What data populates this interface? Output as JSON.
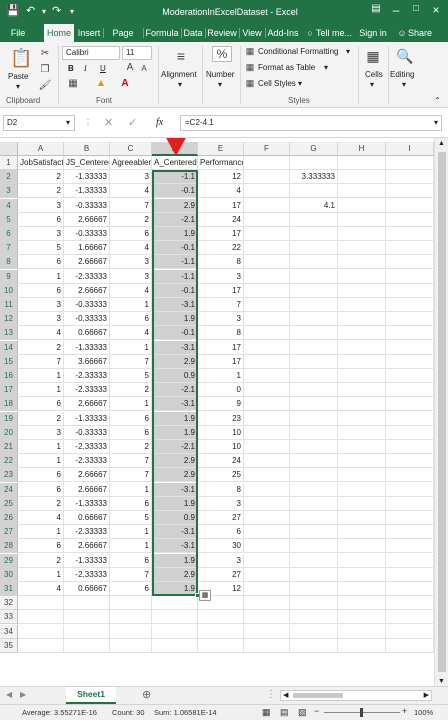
{
  "window": {
    "title": "ModerationInExcelDataset - Excel",
    "signin": "Sign in",
    "share": "Share",
    "tell_me": "Tell me..."
  },
  "tabs": [
    "File",
    "Home",
    "Insert",
    "Page Lay",
    "Formula",
    "Data",
    "Review",
    "View",
    "Add-Ins"
  ],
  "active_tab": "Home",
  "ribbon": {
    "paste": "Paste",
    "clipboard": "Clipboard",
    "font_name": "Calibri",
    "font_size": "11",
    "bold": "B",
    "italic": "I",
    "underline": "U",
    "font_group": "Font",
    "alignment": "Alignment",
    "number": "Number",
    "number_icon": "%",
    "conditional": "Conditional Formatting",
    "format_table": "Format as Table",
    "cell_styles": "Cell Styles",
    "styles_group": "Styles",
    "cells": "Cells",
    "editing": "Editing"
  },
  "formula_bar": {
    "name_box": "D2",
    "fx": "fx",
    "formula": "=C2-4.1"
  },
  "columns": [
    "A",
    "B",
    "C",
    "D",
    "E",
    "F",
    "G",
    "H",
    "I"
  ],
  "selected_column": "D",
  "headers": [
    "JobSatisfaction",
    "JS_Centered",
    "Agreeableness",
    "A_Centered",
    "Performance"
  ],
  "rows": [
    [
      "2",
      "-1.33333",
      "3",
      "-1.1",
      "12"
    ],
    [
      "2",
      "-1.33333",
      "4",
      "-0.1",
      "4"
    ],
    [
      "3",
      "-0.33333",
      "7",
      "2.9",
      "17"
    ],
    [
      "6",
      "2.66667",
      "2",
      "-2.1",
      "24"
    ],
    [
      "3",
      "-0.33333",
      "6",
      "1.9",
      "17"
    ],
    [
      "5",
      "1.66667",
      "4",
      "-0.1",
      "22"
    ],
    [
      "6",
      "2.66667",
      "3",
      "-1.1",
      "8"
    ],
    [
      "1",
      "-2.33333",
      "3",
      "-1.1",
      "3"
    ],
    [
      "6",
      "2.66667",
      "4",
      "-0.1",
      "17"
    ],
    [
      "3",
      "-0.33333",
      "1",
      "-3.1",
      "7"
    ],
    [
      "3",
      "-0.33333",
      "6",
      "1.9",
      "3"
    ],
    [
      "4",
      "0.66667",
      "4",
      "-0.1",
      "8"
    ],
    [
      "2",
      "-1.33333",
      "1",
      "-3.1",
      "17"
    ],
    [
      "7",
      "3.66667",
      "7",
      "2.9",
      "17"
    ],
    [
      "1",
      "-2.33333",
      "5",
      "0.9",
      "1"
    ],
    [
      "1",
      "-2.33333",
      "2",
      "-2.1",
      "0"
    ],
    [
      "6",
      "2.66667",
      "1",
      "-3.1",
      "9"
    ],
    [
      "2",
      "-1.33333",
      "6",
      "1.9",
      "23"
    ],
    [
      "3",
      "-0.33333",
      "6",
      "1.9",
      "10"
    ],
    [
      "1",
      "-2.33333",
      "2",
      "-2.1",
      "10"
    ],
    [
      "1",
      "-2.33333",
      "7",
      "2.9",
      "24"
    ],
    [
      "6",
      "2.66667",
      "7",
      "2.9",
      "25"
    ],
    [
      "6",
      "2.66667",
      "1",
      "-3.1",
      "8"
    ],
    [
      "2",
      "-1.33333",
      "6",
      "1.9",
      "3"
    ],
    [
      "4",
      "0.66667",
      "5",
      "0.9",
      "27"
    ],
    [
      "1",
      "-2.33333",
      "1",
      "-3.1",
      "6"
    ],
    [
      "6",
      "2.66667",
      "1",
      "-3.1",
      "30"
    ],
    [
      "2",
      "-1.33333",
      "6",
      "1.9",
      "3"
    ],
    [
      "1",
      "-2.33333",
      "7",
      "2.9",
      "27"
    ],
    [
      "4",
      "0.66667",
      "6",
      "1.9",
      "12"
    ]
  ],
  "g_values": {
    "G2": "3.333333",
    "G4": "4.1"
  },
  "empty_rows": [
    32,
    33,
    34,
    35
  ],
  "sheet_tab": "Sheet1",
  "status": {
    "average": "Average: 3.55271E-16",
    "count": "Count: 30",
    "sum": "Sum: 1.06581E-14",
    "zoom": "100%"
  },
  "colors": {
    "excel_green": "#217346",
    "arrow": "#e02020"
  }
}
